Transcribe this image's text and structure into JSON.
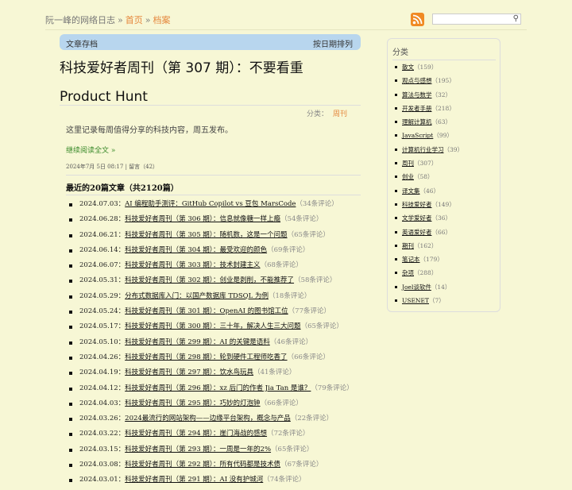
{
  "header": {
    "site": "阮一峰的网络日志",
    "sep": "»",
    "home": "首页",
    "archive": "档案",
    "search_placeholder": ""
  },
  "bar": {
    "left": "文章存档",
    "right": "按日期排列"
  },
  "post": {
    "title_line1": "科技爱好者周刊（第 307 期）：不要看重",
    "title_line2": "Product Hunt",
    "category_label": "分类：",
    "category": "周刊",
    "description": "这里记录每周值得分享的科技内容，周五发布。",
    "read_more": "继续阅读全文 »",
    "meta": "2024年7月 5日 08:17 | 留言（42）"
  },
  "recent": {
    "heading": "最近的20篇文章（共2120篇）",
    "items": [
      {
        "date": "2024.07.03：",
        "title": "AI 编程助手测评：GitHub Copilot vs 豆包 MarsCode",
        "comments": "（34条评论）"
      },
      {
        "date": "2024.06.28：",
        "title": "科技爱好者周刊（第 306 期）：信息就像糖一样上瘾",
        "comments": "（54条评论）"
      },
      {
        "date": "2024.06.21：",
        "title": "科技爱好者周刊（第 305 期）：随机数，这是一个问题",
        "comments": "（65条评论）"
      },
      {
        "date": "2024.06.14：",
        "title": "科技爱好者周刊（第 304 期）：最受欢迎的颜色",
        "comments": "（69条评论）"
      },
      {
        "date": "2024.06.07：",
        "title": "科技爱好者周刊（第 303 期）：技术封建主义",
        "comments": "（68条评论）"
      },
      {
        "date": "2024.05.31：",
        "title": "科技爱好者周刊（第 302 期）：创业是剥削，不能推荐了",
        "comments": "（58条评论）"
      },
      {
        "date": "2024.05.29：",
        "title": "分布式数据库入门：以国产数据库 TDSQL 为例",
        "comments": "（18条评论）"
      },
      {
        "date": "2024.05.24：",
        "title": "科技爱好者周刊（第 301 期）：OpenAI 的图书馆工位",
        "comments": "（77条评论）"
      },
      {
        "date": "2024.05.17：",
        "title": "科技爱好者周刊（第 300 期）：三十年，解决人生三大问题",
        "comments": "（65条评论）"
      },
      {
        "date": "2024.05.10：",
        "title": "科技爱好者周刊（第 299 期）：AI 的关键是语料",
        "comments": "（46条评论）"
      },
      {
        "date": "2024.04.26：",
        "title": "科技爱好者周刊（第 298 期）：轮到硬件工程师吃香了",
        "comments": "（66条评论）"
      },
      {
        "date": "2024.04.19：",
        "title": "科技爱好者周刊（第 297 期）：饮水鸟玩具",
        "comments": "（41条评论）"
      },
      {
        "date": "2024.04.12：",
        "title": "科技爱好者周刊（第 296 期）：xz 后门的作者 Jia Tan 是谁？",
        "comments": "（79条评论）"
      },
      {
        "date": "2024.04.03：",
        "title": "科技爱好者周刊（第 295 期）：巧妙的灯泡钟",
        "comments": "（66条评论）"
      },
      {
        "date": "2024.03.26：",
        "title": "2024最流行的网站架构——边缘平台架构，概念与产品",
        "comments": "（22条评论）"
      },
      {
        "date": "2024.03.22：",
        "title": "科技爱好者周刊（第 294 期）：崖门海战的感想",
        "comments": "（72条评论）"
      },
      {
        "date": "2024.03.15：",
        "title": "科技爱好者周刊（第 293 期）：一周是一年的2%",
        "comments": "（65条评论）"
      },
      {
        "date": "2024.03.08：",
        "title": "科技爱好者周刊（第 292 期）：所有代码都是技术债",
        "comments": "（67条评论）"
      },
      {
        "date": "2024.03.01：",
        "title": "科技爱好者周刊（第 291 期）：AI 没有护城河",
        "comments": "（74条评论）"
      }
    ]
  },
  "sidebar": {
    "title": "分类",
    "categories": [
      {
        "name": "散文",
        "count": "（159）"
      },
      {
        "name": "观点与感想",
        "count": "（195）"
      },
      {
        "name": "算法与数学",
        "count": "（32）"
      },
      {
        "name": "开发者手册",
        "count": "（218）"
      },
      {
        "name": "理解计算机",
        "count": "（63）"
      },
      {
        "name": "JavaScript",
        "count": "（99）"
      },
      {
        "name": "计算机行业学习",
        "count": "（39）"
      },
      {
        "name": "周刊",
        "count": "（307）"
      },
      {
        "name": "创业",
        "count": "（58）"
      },
      {
        "name": "译文集",
        "count": "（46）"
      },
      {
        "name": "科技爱好者",
        "count": "（149）"
      },
      {
        "name": "文学爱好者",
        "count": "（36）"
      },
      {
        "name": "英语爱好者",
        "count": "（66）"
      },
      {
        "name": "期刊",
        "count": "（162）"
      },
      {
        "name": "笔记本",
        "count": "（179）"
      },
      {
        "name": "杂项",
        "count": "（288）"
      },
      {
        "name": "Joel谈软件",
        "count": "（14）"
      },
      {
        "name": "USENET",
        "count": "（7）"
      }
    ]
  }
}
